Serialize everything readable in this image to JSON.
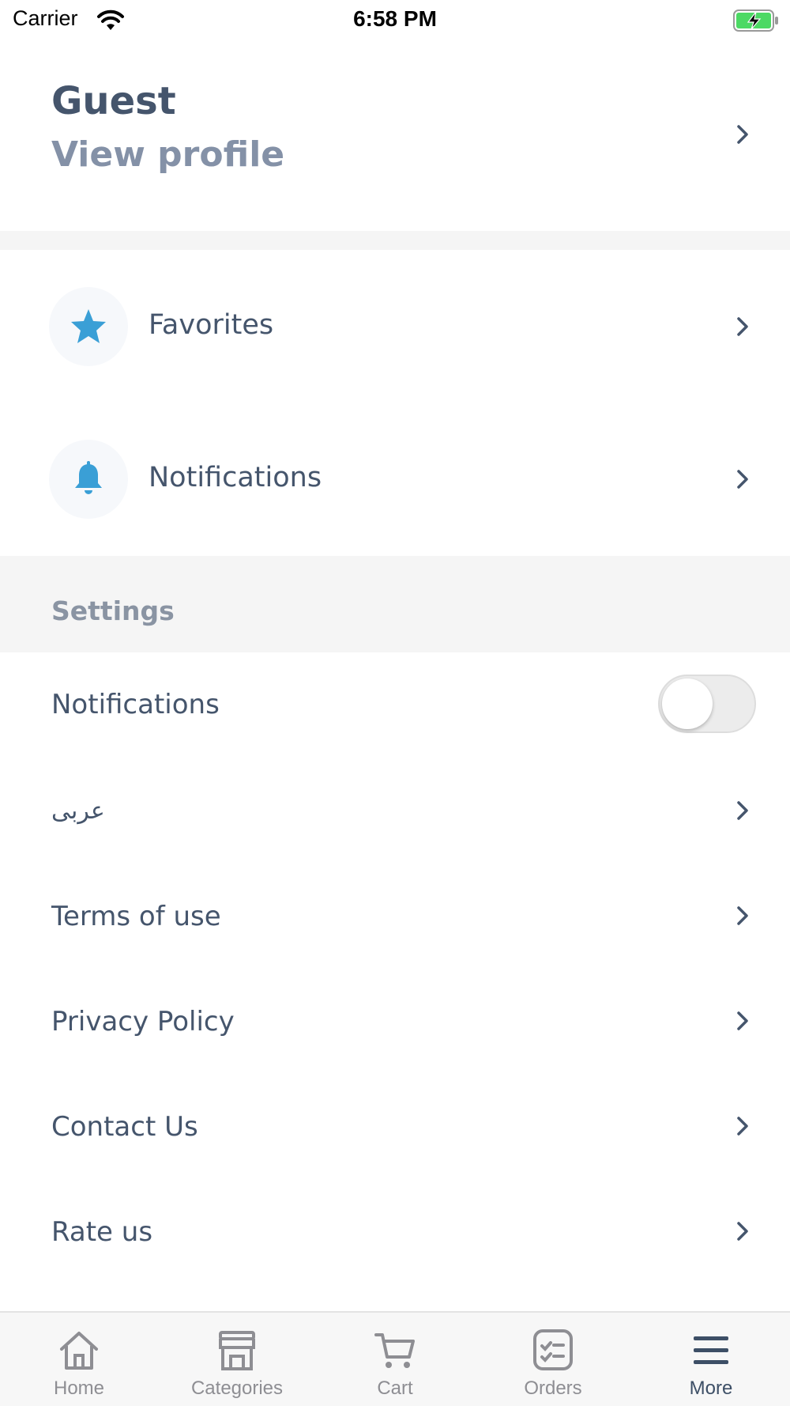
{
  "status_bar": {
    "carrier": "Carrier",
    "time": "6:58 PM"
  },
  "profile": {
    "name": "Guest",
    "link": "View profile"
  },
  "menu": [
    {
      "label": "Favorites",
      "icon": "star-icon"
    },
    {
      "label": "Notifications",
      "icon": "bell-icon"
    }
  ],
  "settings": {
    "title": "Settings",
    "notifications_label": "Notifications",
    "notifications_enabled": false,
    "language_label": "عربى",
    "terms_label": "Terms of use",
    "privacy_label": "Privacy Policy",
    "contact_label": "Contact Us",
    "rate_label": "Rate us"
  },
  "tab_bar": {
    "tabs": [
      {
        "label": "Home",
        "icon": "home-icon"
      },
      {
        "label": "Categories",
        "icon": "store-icon"
      },
      {
        "label": "Cart",
        "icon": "cart-icon"
      },
      {
        "label": "Orders",
        "icon": "orders-icon"
      },
      {
        "label": "More",
        "icon": "menu-icon"
      }
    ],
    "active": "More"
  },
  "colors": {
    "text_primary": "#45556c",
    "text_secondary": "#8491a7",
    "accent": "#3a9fd6",
    "section_background": "#f5f5f5",
    "battery_green": "#4cd964"
  }
}
